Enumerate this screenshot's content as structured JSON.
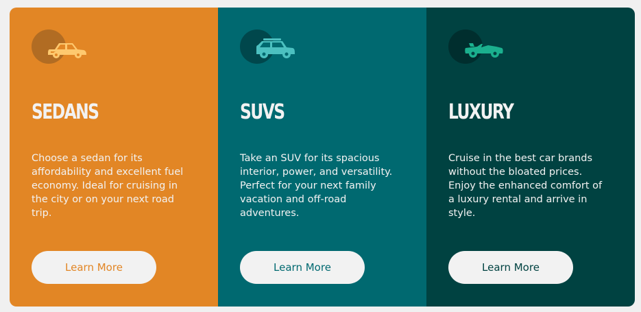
{
  "colors": {
    "page_bg": "#f0f0f0",
    "light_text": "#f2f2f2",
    "button_bg": "#f2f2f2"
  },
  "cards": [
    {
      "title": "SEDANS",
      "description": "Choose a sedan for its affordability and excellent fuel economy. Ideal for cruising in the city or on your next road trip.",
      "button_label": "Learn More",
      "icon": "sedan-car-icon",
      "bg": "#e28625",
      "circle": "#b16c23",
      "icon_color": "#fec96f",
      "button_text": "#e28625"
    },
    {
      "title": "SUVS",
      "description": "Take an SUV for its spacious interior, power, and versatility. Perfect for your next family vacation and off-road adventures.",
      "button_label": "Learn More",
      "icon": "suv-car-icon",
      "bg": "#006970",
      "circle": "#00474c",
      "icon_color": "#4cc0c0",
      "button_text": "#006970"
    },
    {
      "title": "LUXURY",
      "description": "Cruise in the best car brands without the bloated prices. Enjoy the enhanced comfort of a luxury rental and arrive in style.",
      "button_label": "Learn More",
      "icon": "luxury-convertible-icon",
      "bg": "#004241",
      "circle": "#002e2e",
      "icon_color": "#1bb08e",
      "button_text": "#004241"
    }
  ]
}
